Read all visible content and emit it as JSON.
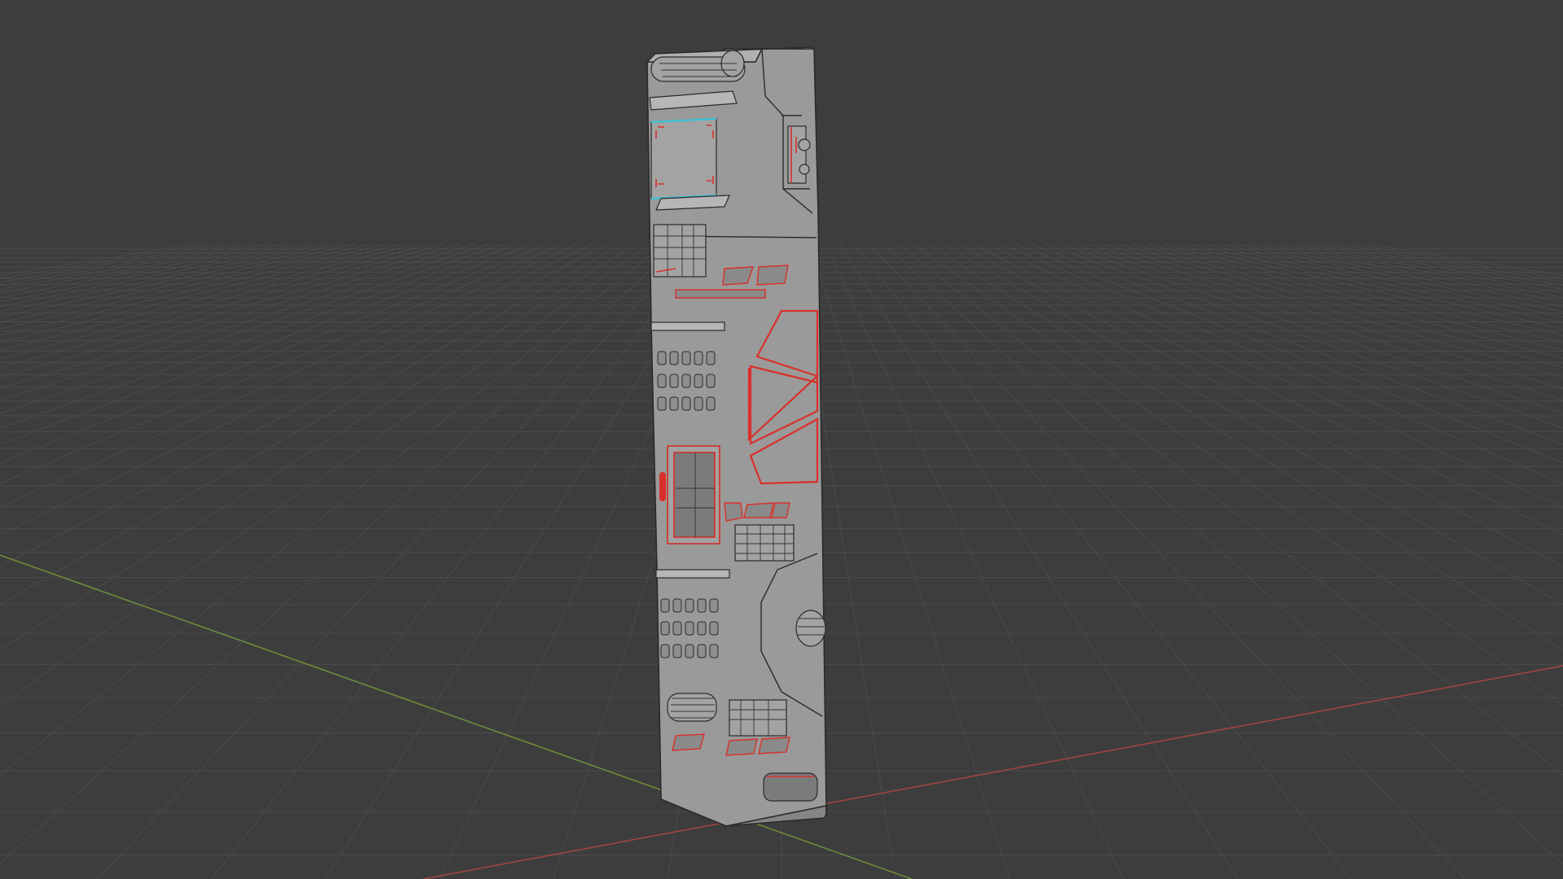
{
  "viewport": {
    "mode": "3d-viewport",
    "shading": "solid-with-wireframe-overlay",
    "background_color": "#3d3d3d",
    "grid_color": "#4b4b4b",
    "x_axis_color": "#a0453e",
    "y_axis_color": "#6d8a3a"
  },
  "model": {
    "object": "sci-fi-hard-surface-pillar",
    "base_color": "#9a9a9a",
    "side_color": "#858585",
    "edge_color": "#2a2a2a",
    "sharp_edge_color": "#d9302a",
    "seam_color": "#3ac3d6"
  }
}
